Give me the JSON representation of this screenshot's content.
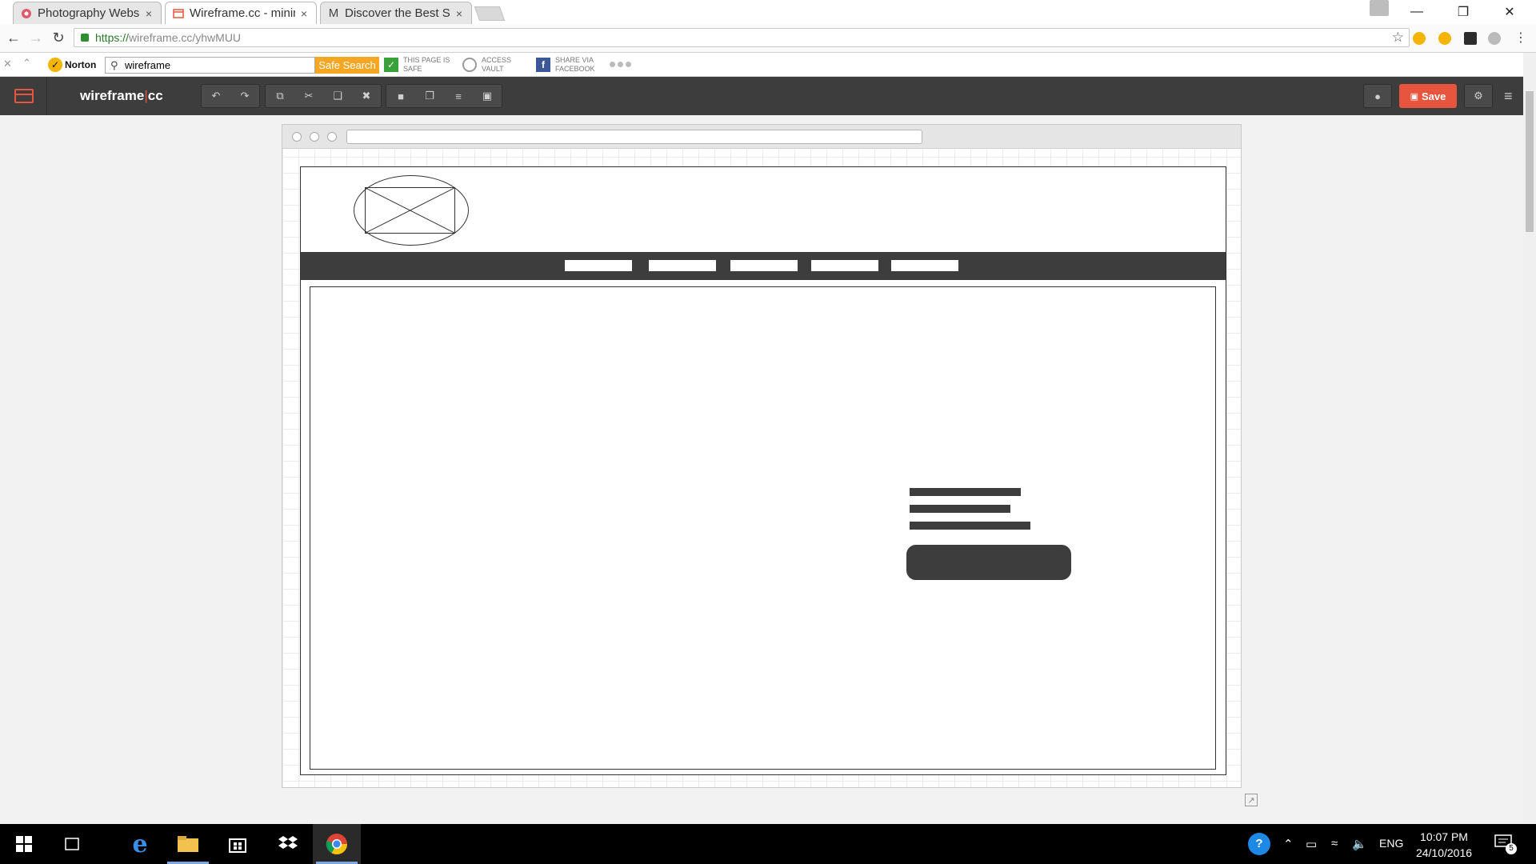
{
  "browser": {
    "tabs": [
      {
        "title": "Photography Website",
        "active": false,
        "icon": "photography-favicon"
      },
      {
        "title": "Wireframe.cc - minimal wireframing tool",
        "active": true,
        "icon": "wireframe-favicon"
      },
      {
        "title": "Discover the Best Sellers",
        "active": false,
        "icon": "m-favicon"
      }
    ],
    "tab_close_glyph": "×",
    "url_scheme": "https://",
    "url_rest": "wireframe.cc/yhwMUU"
  },
  "norton": {
    "logo_text": "Norton",
    "search_value": "wireframe",
    "safe_search_label": "Safe Search",
    "page_safe_label_1": "THIS PAGE IS",
    "page_safe_label_2": "SAFE",
    "vault_label_1": "ACCESS",
    "vault_label_2": "VAULT",
    "share_label_1": "SHARE VIA",
    "share_label_2": "FACEBOOK"
  },
  "app": {
    "title_left": "wireframe",
    "title_right": "cc",
    "save_label": "Save",
    "toolbar_groups": [
      [
        "undo-icon",
        "redo-icon"
      ],
      [
        "copy-icon",
        "cut-icon",
        "paste-icon",
        "delete-icon"
      ],
      [
        "lock-icon",
        "bring-front-icon",
        "align-icon",
        "group-icon"
      ]
    ]
  },
  "taskbar": {
    "language": "ENG",
    "time": "10:07 PM",
    "date": "24/10/2016",
    "notification_count": "5"
  },
  "colors": {
    "app_dark": "#3d3d3d",
    "accent": "#e8553e",
    "norton_yellow": "#f5a623"
  }
}
